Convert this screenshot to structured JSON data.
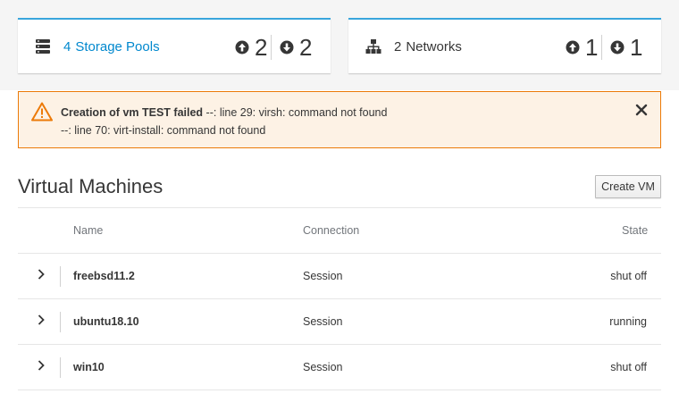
{
  "dashboard": {
    "storage_pools": {
      "count": "4",
      "label": "Storage Pools",
      "active": "2",
      "inactive": "2"
    },
    "networks": {
      "count": "2",
      "label": "Networks",
      "active": "1",
      "inactive": "1"
    }
  },
  "alert": {
    "title": "Creation of vm TEST failed",
    "line1": "--: line 29: virsh: command not found",
    "line2": "--: line 70: virt-install: command not found",
    "close_icon": "close-icon",
    "warning_color": "#ec7a08"
  },
  "vms": {
    "title": "Virtual Machines",
    "create_label": "Create VM",
    "columns": {
      "name": "Name",
      "connection": "Connection",
      "state": "State"
    },
    "rows": [
      {
        "name": "freebsd11.2",
        "connection": "Session",
        "state": "shut off"
      },
      {
        "name": "ubuntu18.10",
        "connection": "Session",
        "state": "running"
      },
      {
        "name": "win10",
        "connection": "Session",
        "state": "shut off"
      }
    ]
  },
  "colors": {
    "accent": "#39a5dc",
    "link": "#0088ce"
  }
}
